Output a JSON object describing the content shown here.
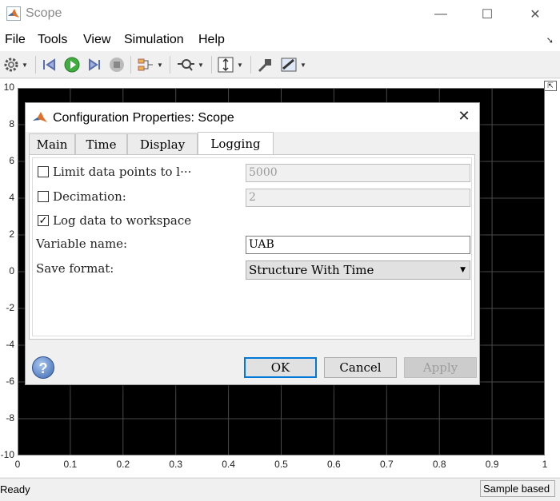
{
  "window": {
    "title": "Scope",
    "min_glyph": "—",
    "max_glyph": "☐",
    "close_glyph": "✕"
  },
  "menu": {
    "items": [
      "File",
      "Tools",
      "View",
      "Simulation",
      "Help"
    ],
    "arrow": "➘"
  },
  "toolbar": {
    "icons": [
      "gear-icon",
      "step-back-icon",
      "run-icon",
      "step-forward-icon",
      "stop-icon",
      "signal-select-icon",
      "zoom-icon",
      "scale-axes-icon",
      "highlight-simulink-block-icon",
      "measurements-icon"
    ]
  },
  "plot": {
    "y_ticks": [
      "10",
      "8",
      "6",
      "4",
      "2",
      "0",
      "-2",
      "-4",
      "-6",
      "-8",
      "-10"
    ],
    "x_ticks": [
      "0",
      "0.1",
      "0.2",
      "0.3",
      "0.4",
      "0.5",
      "0.6",
      "0.7",
      "0.8",
      "0.9",
      "1"
    ]
  },
  "status": {
    "left": "Ready",
    "right": "Sample based"
  },
  "dialog": {
    "title": "Configuration Properties: Scope",
    "close_glyph": "✕",
    "tabs": [
      "Main",
      "Time",
      "Display",
      "Logging"
    ],
    "active_tab": "Logging",
    "limit_points": {
      "label": "Limit data points to l···",
      "checked": false,
      "value": "5000"
    },
    "decimation": {
      "label": "Decimation:",
      "checked": false,
      "value": "2"
    },
    "log_workspace": {
      "label": "Log data to workspace",
      "checked": true,
      "check_glyph": "✓"
    },
    "variable_name": {
      "label": "Variable name:",
      "value": "UAB"
    },
    "save_format": {
      "label": "Save format:",
      "value": "Structure With Time",
      "arrow": "▼"
    },
    "help_glyph": "?",
    "buttons": {
      "ok": "OK",
      "cancel": "Cancel",
      "apply": "Apply"
    }
  }
}
